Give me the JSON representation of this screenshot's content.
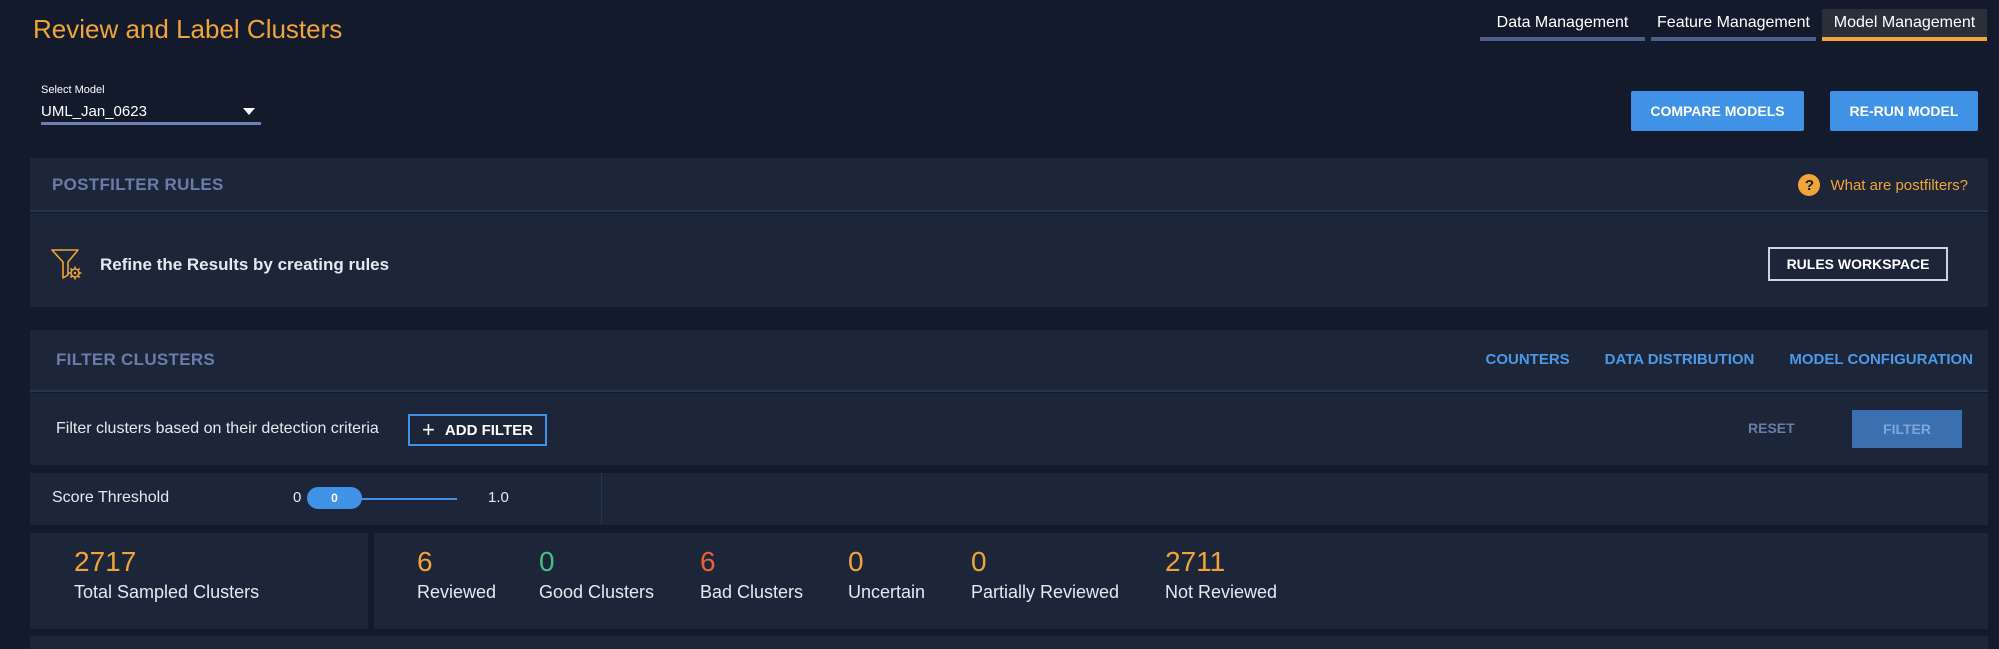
{
  "page": {
    "title": "Review and Label Clusters"
  },
  "nav": {
    "tabs": [
      "Data Management",
      "Feature Management",
      "Model Management"
    ],
    "active": "Model Management"
  },
  "model_select": {
    "label": "Select Model",
    "value": "UML_Jan_0623"
  },
  "actions": {
    "compare": "COMPARE MODELS",
    "rerun": "RE-RUN MODEL"
  },
  "postfilter": {
    "title": "POSTFILTER RULES",
    "help": "What are postfilters?",
    "message": "Refine the Results by creating rules",
    "workspace_button": "RULES WORKSPACE"
  },
  "filter_clusters": {
    "title": "FILTER CLUSTERS",
    "links": [
      "COUNTERS",
      "DATA DISTRIBUTION",
      "MODEL CONFIGURATION"
    ],
    "message": "Filter clusters based on their detection criteria",
    "add_filter": "ADD FILTER",
    "reset": "RESET",
    "filter": "FILTER"
  },
  "score_threshold": {
    "label": "Score Threshold",
    "min": "0",
    "max": "1.0",
    "value": "0"
  },
  "stats": {
    "total": {
      "value": "2717",
      "label": "Total Sampled Clusters"
    },
    "items": [
      {
        "value": "6",
        "label": "Reviewed",
        "color": "#f0a43a"
      },
      {
        "value": "0",
        "label": "Good Clusters",
        "color": "#3fbf8a"
      },
      {
        "value": "6",
        "label": "Bad Clusters",
        "color": "#e8613a"
      },
      {
        "value": "0",
        "label": "Uncertain",
        "color": "#f0a43a"
      },
      {
        "value": "0",
        "label": "Partially Reviewed",
        "color": "#f0a43a"
      },
      {
        "value": "2711",
        "label": "Not Reviewed",
        "color": "#f0a43a"
      }
    ]
  },
  "colors": {
    "accent": "#f0a43a",
    "primary": "#3f92e6",
    "background": "#121a2b",
    "panel": "#1d2538"
  }
}
